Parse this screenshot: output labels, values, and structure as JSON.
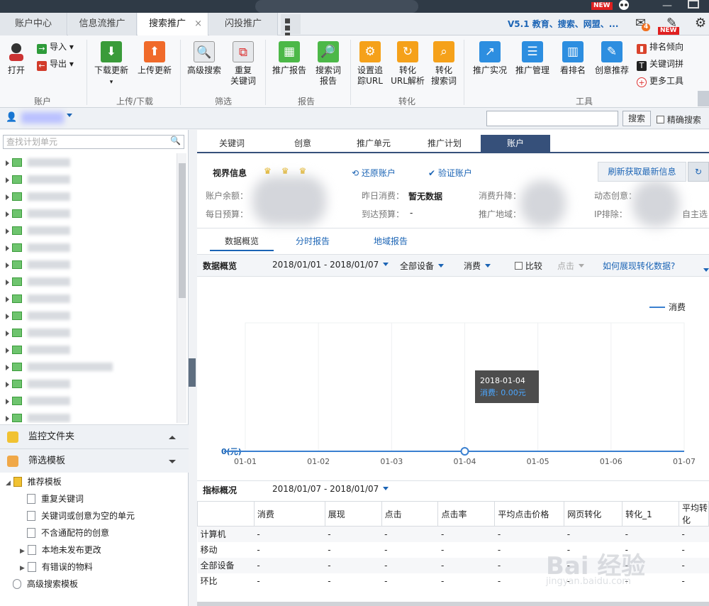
{
  "title_bar": {
    "new_badge": "NEW"
  },
  "tabs": [
    {
      "label": "账户中心"
    },
    {
      "label": "信息流推广"
    },
    {
      "label": "搜索推广",
      "close": "×"
    },
    {
      "label": "闪投推广"
    }
  ],
  "version_text": "V5.1 教育、搜索、网盟、...",
  "notif_count": "4",
  "new_badge2": "NEW",
  "ribbon": {
    "open": "打开",
    "import": "导入",
    "export": "导出",
    "download_update": "下载更新",
    "upload_update": "上传更新",
    "advanced_search": "高级搜索",
    "duplicate_kw_line1": "重复",
    "duplicate_kw_line2": "关键词",
    "promo_report": "推广报告",
    "search_term_line1": "搜索词",
    "search_term_line2": "报告",
    "set_track_line1": "设置追",
    "set_track_line2": "踪URL",
    "convert_url_line1": "转化",
    "convert_url_line2": "URL解析",
    "convert_term_line1": "转化",
    "convert_term_line2": "搜索词",
    "promo_live": "推广实况",
    "promo_manage": "推广管理",
    "view_rank": "看排名",
    "creative_rec": "创意推荐",
    "rank_trend": "排名倾向",
    "keyword_pin": "关键词拼",
    "more_tools": "更多工具",
    "groups": {
      "account": "账户",
      "updown": "上传/下载",
      "filter": "筛选",
      "report": "报告",
      "convert": "转化",
      "tools": "工具"
    }
  },
  "userbar": {
    "search_btn": "搜索",
    "exact_search": "精确搜索"
  },
  "left": {
    "search_placeholder": "查找计划单元",
    "monitor_folder": "监控文件夹",
    "filter_template": "筛选模板",
    "recommend_template": "推荐模板",
    "items": [
      "重复关键词",
      "关键词或创意为空的单元",
      "不含通配符的创意",
      "本地未发布更改",
      "有错误的物料"
    ],
    "advanced_template": "高级搜索模板"
  },
  "main_tabs": [
    "关键词",
    "创意",
    "推广单元",
    "推广计划",
    "账户"
  ],
  "info": {
    "vision": "视界信息",
    "restore_account": "还原账户",
    "verify_account": "验证账户",
    "refresh": "刷新获取最新信息",
    "balance_label": "账户余额：",
    "daily_budget_label": "每日预算：",
    "yesterday_cost_label": "昨日消费：",
    "yesterday_cost_value": "暂无数据",
    "reach_budget_label": "到达预算：",
    "reach_budget_value": "-",
    "cost_change_label": "消费升降：",
    "region_label": "推广地域：",
    "dynamic_creative_label": "动态创意：",
    "ip_exclude_label": "IP排除：",
    "auto_label": "自主选"
  },
  "report_tabs": [
    "数据概览",
    "分时报告",
    "地域报告"
  ],
  "overview": {
    "title": "数据概览",
    "date_range": "2018/01/01 - 2018/01/07",
    "device": "全部设备",
    "metric": "消费",
    "compare": "比较",
    "click": "点击",
    "how_link": "如何展现转化数据?"
  },
  "chart_data": {
    "type": "line",
    "categories": [
      "01-01",
      "01-02",
      "01-03",
      "01-04",
      "01-05",
      "01-06",
      "01-07"
    ],
    "series": [
      {
        "name": "消费",
        "values": [
          0,
          0,
          0,
          0,
          0,
          0,
          0
        ]
      }
    ],
    "ylabel": "0(元)",
    "legend_position": "top-right",
    "tooltip": {
      "date": "2018-01-04",
      "text": "消费: 0.00元"
    },
    "colors": {
      "line": "#3a80d0"
    }
  },
  "summary": {
    "title": "指标概况",
    "date_range": "2018/01/07 - 2018/01/07",
    "columns": [
      "",
      "消费",
      "展现",
      "点击",
      "点击率",
      "平均点击价格",
      "网页转化",
      "转化_1",
      "平均转化"
    ],
    "rows": [
      [
        "计算机",
        "-",
        "-",
        "-",
        "-",
        "-",
        "-",
        "-",
        "-"
      ],
      [
        "移动",
        "-",
        "-",
        "-",
        "-",
        "-",
        "-",
        "-",
        "-"
      ],
      [
        "全部设备",
        "-",
        "-",
        "-",
        "-",
        "-",
        "-",
        "-",
        "-"
      ],
      [
        "环比",
        "-",
        "-",
        "-",
        "-",
        "-",
        "-",
        "-",
        "-"
      ]
    ]
  },
  "watermark": {
    "main": "Bai 经验",
    "sub": "jingyan.baidu.com"
  }
}
